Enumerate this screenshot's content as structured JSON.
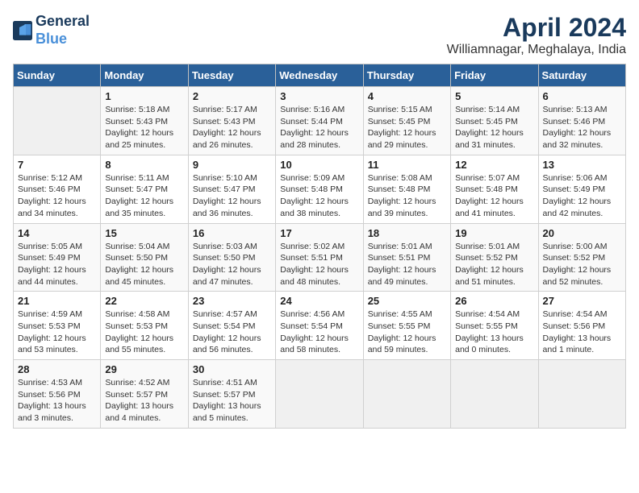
{
  "header": {
    "logo_line1": "General",
    "logo_line2": "Blue",
    "title": "April 2024",
    "subtitle": "Williamnagar, Meghalaya, India"
  },
  "weekdays": [
    "Sunday",
    "Monday",
    "Tuesday",
    "Wednesday",
    "Thursday",
    "Friday",
    "Saturday"
  ],
  "weeks": [
    [
      {
        "day": "",
        "text": ""
      },
      {
        "day": "1",
        "text": "Sunrise: 5:18 AM\nSunset: 5:43 PM\nDaylight: 12 hours\nand 25 minutes."
      },
      {
        "day": "2",
        "text": "Sunrise: 5:17 AM\nSunset: 5:43 PM\nDaylight: 12 hours\nand 26 minutes."
      },
      {
        "day": "3",
        "text": "Sunrise: 5:16 AM\nSunset: 5:44 PM\nDaylight: 12 hours\nand 28 minutes."
      },
      {
        "day": "4",
        "text": "Sunrise: 5:15 AM\nSunset: 5:45 PM\nDaylight: 12 hours\nand 29 minutes."
      },
      {
        "day": "5",
        "text": "Sunrise: 5:14 AM\nSunset: 5:45 PM\nDaylight: 12 hours\nand 31 minutes."
      },
      {
        "day": "6",
        "text": "Sunrise: 5:13 AM\nSunset: 5:46 PM\nDaylight: 12 hours\nand 32 minutes."
      }
    ],
    [
      {
        "day": "7",
        "text": "Sunrise: 5:12 AM\nSunset: 5:46 PM\nDaylight: 12 hours\nand 34 minutes."
      },
      {
        "day": "8",
        "text": "Sunrise: 5:11 AM\nSunset: 5:47 PM\nDaylight: 12 hours\nand 35 minutes."
      },
      {
        "day": "9",
        "text": "Sunrise: 5:10 AM\nSunset: 5:47 PM\nDaylight: 12 hours\nand 36 minutes."
      },
      {
        "day": "10",
        "text": "Sunrise: 5:09 AM\nSunset: 5:48 PM\nDaylight: 12 hours\nand 38 minutes."
      },
      {
        "day": "11",
        "text": "Sunrise: 5:08 AM\nSunset: 5:48 PM\nDaylight: 12 hours\nand 39 minutes."
      },
      {
        "day": "12",
        "text": "Sunrise: 5:07 AM\nSunset: 5:48 PM\nDaylight: 12 hours\nand 41 minutes."
      },
      {
        "day": "13",
        "text": "Sunrise: 5:06 AM\nSunset: 5:49 PM\nDaylight: 12 hours\nand 42 minutes."
      }
    ],
    [
      {
        "day": "14",
        "text": "Sunrise: 5:05 AM\nSunset: 5:49 PM\nDaylight: 12 hours\nand 44 minutes."
      },
      {
        "day": "15",
        "text": "Sunrise: 5:04 AM\nSunset: 5:50 PM\nDaylight: 12 hours\nand 45 minutes."
      },
      {
        "day": "16",
        "text": "Sunrise: 5:03 AM\nSunset: 5:50 PM\nDaylight: 12 hours\nand 47 minutes."
      },
      {
        "day": "17",
        "text": "Sunrise: 5:02 AM\nSunset: 5:51 PM\nDaylight: 12 hours\nand 48 minutes."
      },
      {
        "day": "18",
        "text": "Sunrise: 5:01 AM\nSunset: 5:51 PM\nDaylight: 12 hours\nand 49 minutes."
      },
      {
        "day": "19",
        "text": "Sunrise: 5:01 AM\nSunset: 5:52 PM\nDaylight: 12 hours\nand 51 minutes."
      },
      {
        "day": "20",
        "text": "Sunrise: 5:00 AM\nSunset: 5:52 PM\nDaylight: 12 hours\nand 52 minutes."
      }
    ],
    [
      {
        "day": "21",
        "text": "Sunrise: 4:59 AM\nSunset: 5:53 PM\nDaylight: 12 hours\nand 53 minutes."
      },
      {
        "day": "22",
        "text": "Sunrise: 4:58 AM\nSunset: 5:53 PM\nDaylight: 12 hours\nand 55 minutes."
      },
      {
        "day": "23",
        "text": "Sunrise: 4:57 AM\nSunset: 5:54 PM\nDaylight: 12 hours\nand 56 minutes."
      },
      {
        "day": "24",
        "text": "Sunrise: 4:56 AM\nSunset: 5:54 PM\nDaylight: 12 hours\nand 58 minutes."
      },
      {
        "day": "25",
        "text": "Sunrise: 4:55 AM\nSunset: 5:55 PM\nDaylight: 12 hours\nand 59 minutes."
      },
      {
        "day": "26",
        "text": "Sunrise: 4:54 AM\nSunset: 5:55 PM\nDaylight: 13 hours\nand 0 minutes."
      },
      {
        "day": "27",
        "text": "Sunrise: 4:54 AM\nSunset: 5:56 PM\nDaylight: 13 hours\nand 1 minute."
      }
    ],
    [
      {
        "day": "28",
        "text": "Sunrise: 4:53 AM\nSunset: 5:56 PM\nDaylight: 13 hours\nand 3 minutes."
      },
      {
        "day": "29",
        "text": "Sunrise: 4:52 AM\nSunset: 5:57 PM\nDaylight: 13 hours\nand 4 minutes."
      },
      {
        "day": "30",
        "text": "Sunrise: 4:51 AM\nSunset: 5:57 PM\nDaylight: 13 hours\nand 5 minutes."
      },
      {
        "day": "",
        "text": ""
      },
      {
        "day": "",
        "text": ""
      },
      {
        "day": "",
        "text": ""
      },
      {
        "day": "",
        "text": ""
      }
    ]
  ]
}
